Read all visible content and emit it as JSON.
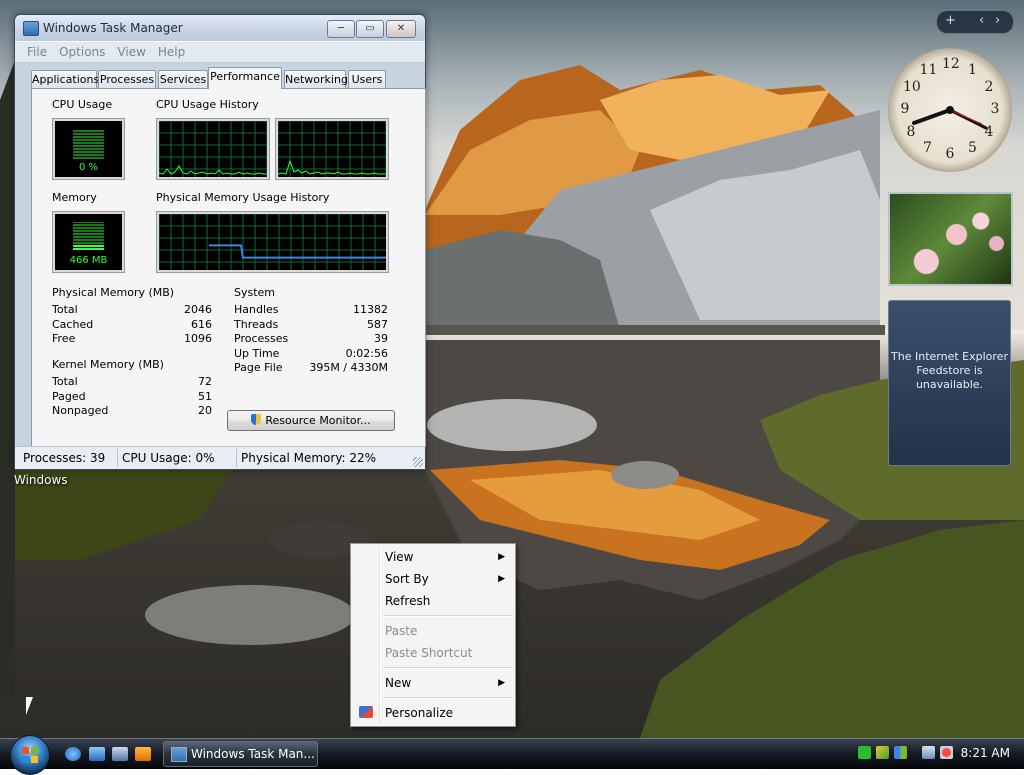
{
  "window": {
    "title": "Windows Task Manager",
    "minimize_glyph": "─",
    "maximize_glyph": "▭",
    "close_glyph": "✕"
  },
  "menu": [
    "File",
    "Options",
    "View",
    "Help"
  ],
  "tabs": [
    {
      "label": "Applications",
      "active": false
    },
    {
      "label": "Processes",
      "active": false
    },
    {
      "label": "Services",
      "active": false
    },
    {
      "label": "Performance",
      "active": true
    },
    {
      "label": "Networking",
      "active": false
    },
    {
      "label": "Users",
      "active": false
    }
  ],
  "performance": {
    "cpu_usage_label": "CPU Usage",
    "cpu_usage_value": "0 %",
    "cpu_usage_fraction": 0,
    "cpu_history_label": "CPU Usage History",
    "memory_label": "Memory",
    "memory_value": "466 MB",
    "memory_fraction": 0.22,
    "physical_memory_history_label": "Physical Memory Usage History",
    "physical_memory": {
      "title": "Physical Memory (MB)",
      "rows": [
        {
          "key": "Total",
          "value": "2046"
        },
        {
          "key": "Cached",
          "value": "616"
        },
        {
          "key": "Free",
          "value": "1096"
        }
      ]
    },
    "kernel_memory": {
      "title": "Kernel Memory (MB)",
      "rows": [
        {
          "key": "Total",
          "value": "72"
        },
        {
          "key": "Paged",
          "value": "51"
        },
        {
          "key": "Nonpaged",
          "value": "20"
        }
      ]
    },
    "system": {
      "title": "System",
      "rows": [
        {
          "key": "Handles",
          "value": "11382"
        },
        {
          "key": "Threads",
          "value": "587"
        },
        {
          "key": "Processes",
          "value": "39"
        },
        {
          "key": "Up Time",
          "value": "0:02:56"
        },
        {
          "key": "Page File",
          "value": "395M / 4330M"
        }
      ]
    },
    "resource_monitor_button": "Resource Monitor..."
  },
  "status_bar": {
    "processes": "Processes: 39",
    "cpu_usage": "CPU Usage: 0%",
    "physical_memory": "Physical Memory: 22%"
  },
  "desktop": {
    "icon_label": "Windows",
    "sidebar_add": "+",
    "sidebar_prev": "‹",
    "sidebar_next": "›",
    "feed_message": "The Internet Explorer Feedstore is unavailable."
  },
  "clock": {
    "numerals": [
      "12",
      "1",
      "2",
      "3",
      "4",
      "5",
      "6",
      "7",
      "8",
      "9",
      "10",
      "11"
    ]
  },
  "context_menu": {
    "items": [
      {
        "label": "View",
        "submenu": true,
        "disabled": false
      },
      {
        "label": "Sort By",
        "submenu": true,
        "disabled": false
      },
      {
        "label": "Refresh",
        "submenu": false,
        "disabled": false
      },
      {
        "label": "Paste",
        "submenu": false,
        "disabled": true
      },
      {
        "label": "Paste Shortcut",
        "submenu": false,
        "disabled": true
      },
      {
        "label": "New",
        "submenu": true,
        "disabled": false
      },
      {
        "label": "Personalize",
        "submenu": false,
        "disabled": false
      }
    ],
    "submenu_arrow": "▶"
  },
  "taskbar": {
    "task_button": "Windows Task Man...",
    "time": "8:21 AM"
  },
  "colors": {
    "graph_green": "#2bff2b",
    "graph_grid": "#0a6b33",
    "memory_line": "#3b86e6"
  }
}
